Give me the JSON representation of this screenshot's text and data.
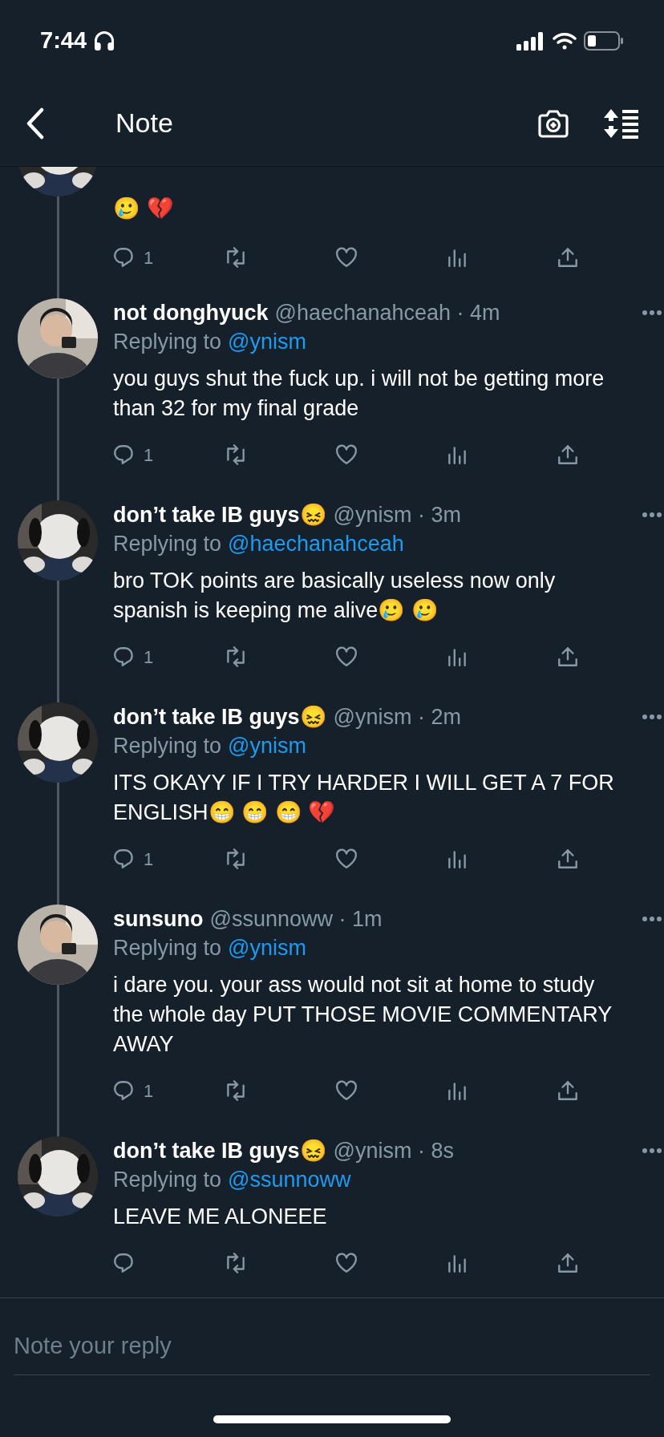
{
  "status_bar": {
    "time": "7:44"
  },
  "header": {
    "title": "Note"
  },
  "tweets": [
    {
      "partial": true,
      "text": "🥲 💔",
      "reply_count": "1"
    },
    {
      "partial": false,
      "name": "not donghyuck",
      "meta": "@haechanahceah · 4m",
      "replying_label": "Replying to",
      "reply_to": "@ynism",
      "text": "you guys shut the fuck up. i will not be getting more than 32 for my final grade",
      "reply_count": "1"
    },
    {
      "partial": false,
      "name": "don’t take IB guys😖",
      "meta": "@ynism · 3m",
      "replying_label": "Replying to",
      "reply_to": "@haechanahceah",
      "text": "bro TOK points are basically useless now only spanish is keeping me alive🥲 🥲",
      "reply_count": "1"
    },
    {
      "partial": false,
      "name": "don’t take IB guys😖",
      "meta": "@ynism · 2m",
      "replying_label": "Replying to",
      "reply_to": "@ynism",
      "text": "ITS OKAYY IF I TRY HARDER I WILL GET A 7 FOR ENGLISH😁 😁 😁 💔",
      "reply_count": "1"
    },
    {
      "partial": false,
      "name": "sunsuno",
      "meta": "@ssunnoww · 1m",
      "replying_label": "Replying to",
      "reply_to": "@ynism",
      "text": "i dare you. your ass would not sit at home to study the whole day PUT THOSE MOVIE COMMENTARY AWAY",
      "reply_count": "1"
    },
    {
      "partial": false,
      "name": "don’t take IB guys😖",
      "meta": "@ynism · 8s",
      "replying_label": "Replying to",
      "reply_to": "@ssunnoww",
      "text": "LEAVE ME ALONEEE"
    }
  ],
  "reply_field": {
    "placeholder": "Note your reply"
  }
}
